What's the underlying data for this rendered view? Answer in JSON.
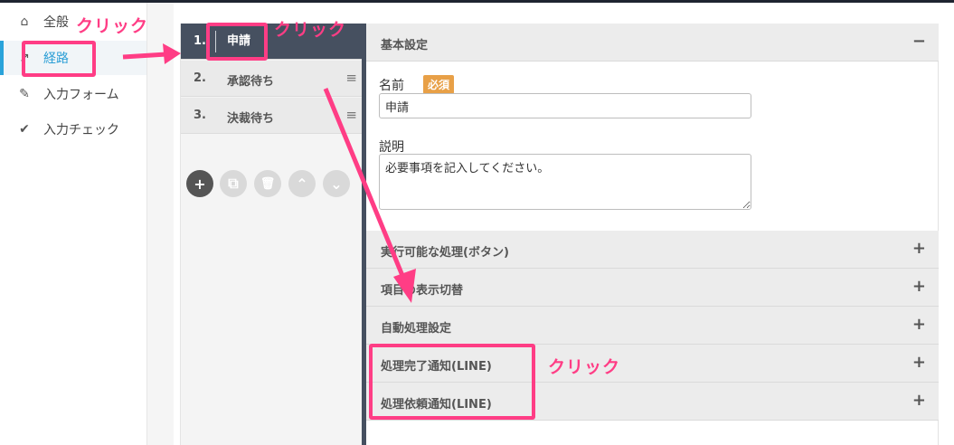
{
  "nav": {
    "items": [
      {
        "label": "全般",
        "icon": "home-icon",
        "glyph": "⌂"
      },
      {
        "label": "経路",
        "icon": "route-icon",
        "glyph": "↗",
        "active": true
      },
      {
        "label": "入力フォーム",
        "icon": "pencil-icon",
        "glyph": "✎"
      },
      {
        "label": "入力チェック",
        "icon": "check-icon",
        "glyph": "✔"
      }
    ]
  },
  "steps": [
    {
      "num": "1.",
      "name": "申請",
      "active": true
    },
    {
      "num": "2.",
      "name": "承認待ち"
    },
    {
      "num": "3.",
      "name": "決裁待ち"
    }
  ],
  "step_grip": "≡",
  "toolbar": {
    "add": "+",
    "copy": "⧉",
    "delete": "🗑",
    "up": "⌃",
    "down": "⌄"
  },
  "pane": {
    "basic": {
      "title": "基本設定",
      "toggle": "−"
    },
    "name_label": "名前",
    "required_badge": "必須",
    "name_value": "申請",
    "desc_label": "説明",
    "desc_value": "必要事項を記入してください。",
    "sections": [
      {
        "title": "実行可能な処理(ボタン)",
        "toggle": "+"
      },
      {
        "title": "項目の表示切替",
        "toggle": "+"
      },
      {
        "title": "自動処理設定",
        "toggle": "+"
      },
      {
        "title": "処理完了通知(LINE)",
        "toggle": "+"
      },
      {
        "title": "処理依頼通知(LINE)",
        "toggle": "+"
      }
    ]
  },
  "annotations": {
    "click1": "クリック",
    "click2": "クリック",
    "click3": "クリック",
    "accent": "#ff3d85"
  }
}
